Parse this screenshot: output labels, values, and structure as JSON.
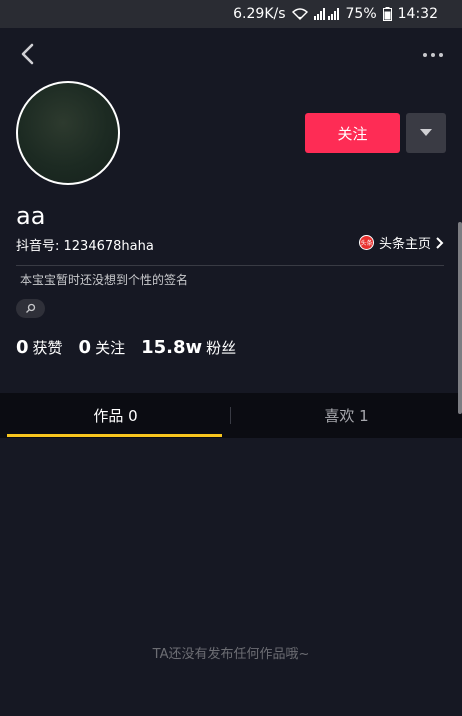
{
  "status_bar": {
    "speed": "6.29K/s",
    "battery": "75%",
    "time": "14:32"
  },
  "profile": {
    "nickname": "aa",
    "douyin_id": "抖音号: 1234678haha",
    "toutiao_label": "头条主页",
    "toutiao_badge": "头条",
    "signature": "本宝宝暂时还没想到个性的签名",
    "follow_label": "关注"
  },
  "stats": {
    "likes_num": "0",
    "likes_label": "获赞",
    "following_num": "0",
    "following_label": "关注",
    "fans_num": "15.8w",
    "fans_label": "粉丝"
  },
  "tabs": {
    "works": "作品 0",
    "likes": "喜欢 1"
  },
  "empty": {
    "text": "TA还没有发布任何作品哦~"
  },
  "colors": {
    "background": "#161823",
    "accent": "#fe2c55",
    "tab_indicator": "#f7c51e"
  }
}
